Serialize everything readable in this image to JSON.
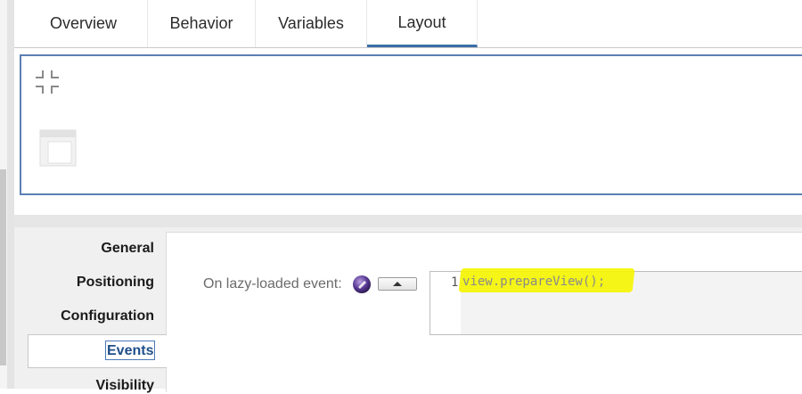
{
  "tabs": [
    {
      "label": "Overview"
    },
    {
      "label": "Behavior"
    },
    {
      "label": "Variables"
    },
    {
      "label": "Layout"
    }
  ],
  "active_tab": "Layout",
  "preview": {
    "icons": [
      "collapse-icon",
      "layout-widget-icon"
    ]
  },
  "sidebar": {
    "items": [
      {
        "label": "General"
      },
      {
        "label": "Positioning"
      },
      {
        "label": "Configuration"
      },
      {
        "label": "Events"
      },
      {
        "label": "Visibility"
      }
    ],
    "selected": "Events"
  },
  "event": {
    "label": "On lazy-loaded event:",
    "icon": "script-icon"
  },
  "editor": {
    "line_number": "1",
    "code": "view.prepareView();"
  },
  "colors": {
    "accent": "#3a6ea8",
    "panel_border": "#5b7fb5",
    "highlight": "#f5f500"
  }
}
